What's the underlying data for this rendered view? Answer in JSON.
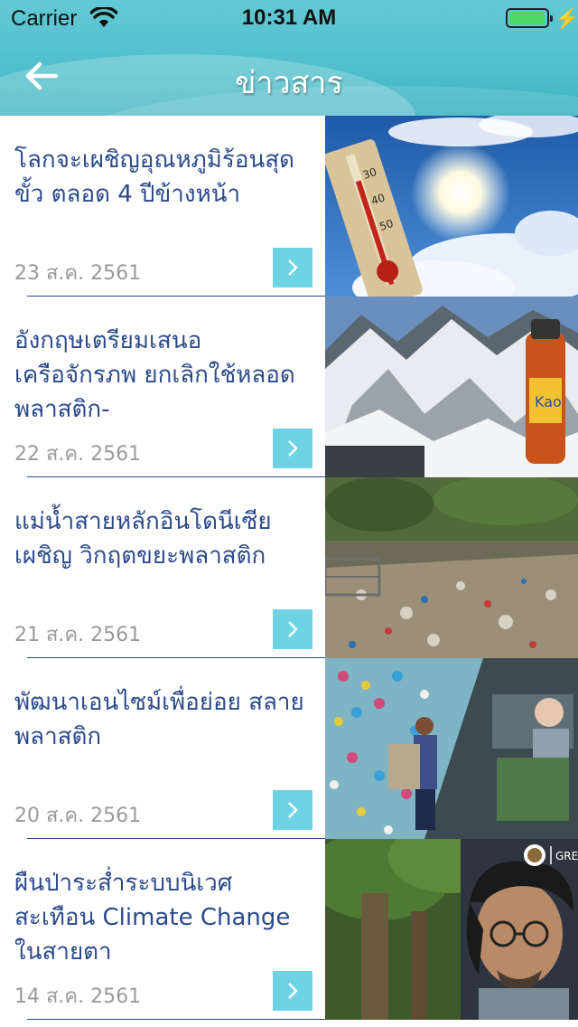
{
  "status_bar": {
    "carrier": "Carrier",
    "time": "10:31 AM"
  },
  "nav": {
    "title": "ข่าวสาร"
  },
  "news": [
    {
      "title": "โลกจะเผชิญอุณหภูมิร้อนสุดขั้ว ตลอด 4 ปีข้างหน้า",
      "date": "23 ส.ค. 2561",
      "image": "thermometer-sun-sky"
    },
    {
      "title": "อังกฤษเตรียมเสนอเครือจักรภพ ยกเลิกใช้หลอดพลาสติก-",
      "date": "22 ส.ค. 2561",
      "image": "snowy-mountains-bottle"
    },
    {
      "title": "แม่น้ำสายหลักอินโดนีเซียเผชิญ วิกฤตขยะพลาสติก",
      "date": "21 ส.ค. 2561",
      "image": "river-plastic-waste"
    },
    {
      "title": "พัฒนาเอนไซม์เพื่อย่อย สลายพลาสติก",
      "date": "20 ส.ค. 2561",
      "image": "plastic-bottles-lab"
    },
    {
      "title": "ผืนป่าระส่ำระบบนิเวศสะเทือน Climate Change ในสายตา",
      "date": "14 ส.ค. 2561",
      "image": "forest-man-portrait",
      "thumb_text": "GREE"
    }
  ]
}
